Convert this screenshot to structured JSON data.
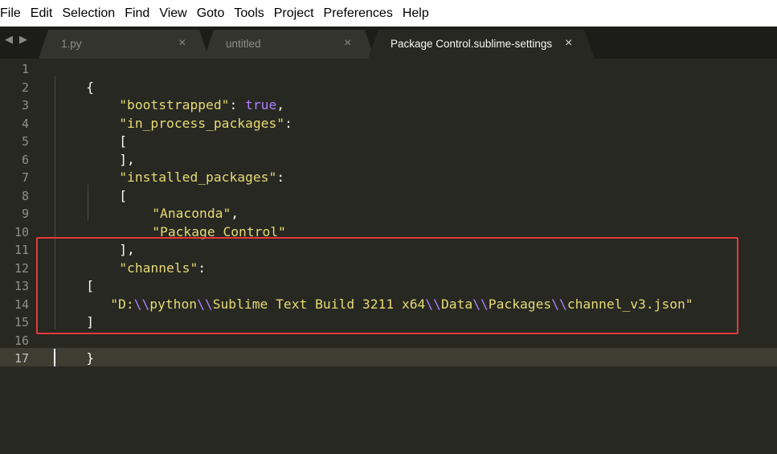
{
  "menu": [
    "File",
    "Edit",
    "Selection",
    "Find",
    "View",
    "Goto",
    "Tools",
    "Project",
    "Preferences",
    "Help"
  ],
  "tabs": [
    {
      "label": "1.py",
      "close": "×",
      "active": false
    },
    {
      "label": "untitled",
      "close": "×",
      "active": false
    },
    {
      "label": "Package Control.sublime-settings",
      "close": "×",
      "active": true
    }
  ],
  "nav": {
    "back": "◀",
    "forward": "▶"
  },
  "gutter": [
    "1",
    "2",
    "3",
    "4",
    "5",
    "6",
    "7",
    "8",
    "9",
    "10",
    "11",
    "12",
    "13",
    "14",
    "15",
    "16",
    "17"
  ],
  "current_line": 17,
  "code": {
    "l1_brace": "{",
    "l2_key": "\"bootstrapped\"",
    "l2_colon": ": ",
    "l2_val": "true",
    "l2_comma": ",",
    "l3_key": "\"in_process_packages\"",
    "l3_colon": ":",
    "l4": "[",
    "l5": "],",
    "l6_key": "\"installed_packages\"",
    "l6_colon": ":",
    "l7": "[",
    "l8_str": "\"Anaconda\"",
    "l8_comma": ",",
    "l9_str": "\"Package Control\"",
    "l10": "],",
    "l11_key": "\"channels\"",
    "l11_colon": ":",
    "l12": "[",
    "l13_q1": "\"D:",
    "l13_e1": "\\\\",
    "l13_s1": "python",
    "l13_e2": "\\\\",
    "l13_s2": "Sublime Text Build 3211 x64",
    "l13_e3": "\\\\",
    "l13_s3": "Data",
    "l13_e4": "\\\\",
    "l13_s4": "Packages",
    "l13_e5": "\\\\",
    "l13_s5": "channel_v3.json\"",
    "l14": "]",
    "l16": "}"
  },
  "colors": {
    "background": "#272822",
    "string": "#e6db74",
    "constant": "#ae81ff",
    "highlight_box": "#e5383b"
  }
}
